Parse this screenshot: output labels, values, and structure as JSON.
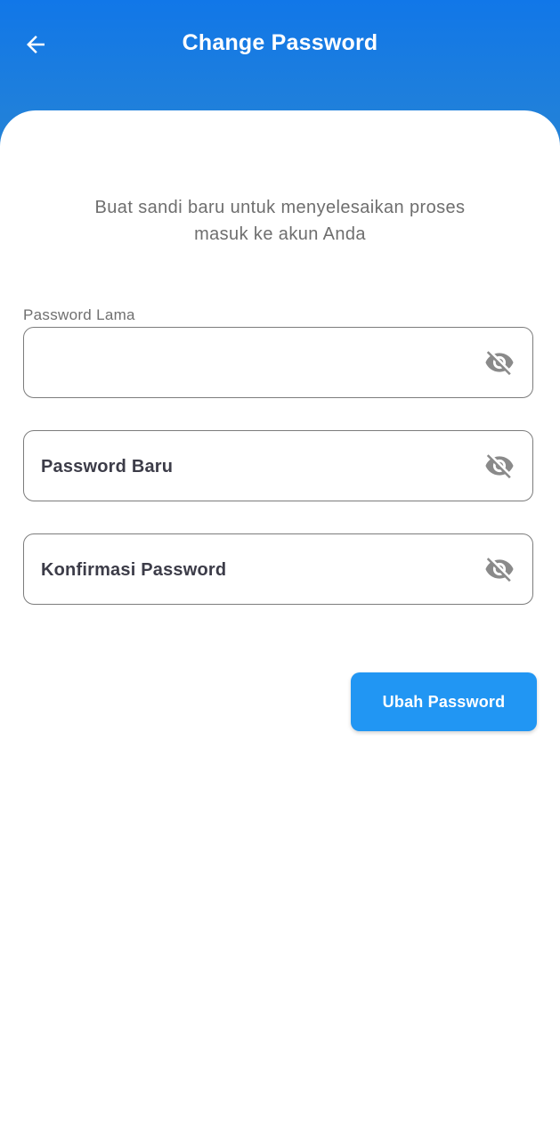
{
  "header": {
    "title": "Change Password",
    "back_icon": "arrow-left-icon",
    "gradient_top": "#1177e8",
    "gradient_bottom": "#2583d6"
  },
  "intro": {
    "line1": "Buat sandi baru untuk menyelesaikan proses",
    "line2": "masuk ke akun Anda"
  },
  "form": {
    "old_password": {
      "label": "Password Lama",
      "value": "",
      "toggle_icon": "eye-off-icon"
    },
    "new_password": {
      "label": "Password Baru",
      "toggle_icon": "eye-off-icon"
    },
    "confirm_password": {
      "label": "Konfirmasi Password",
      "toggle_icon": "eye-off-icon"
    }
  },
  "submit": {
    "label": "Ubah Password",
    "color": "#2196f3"
  }
}
